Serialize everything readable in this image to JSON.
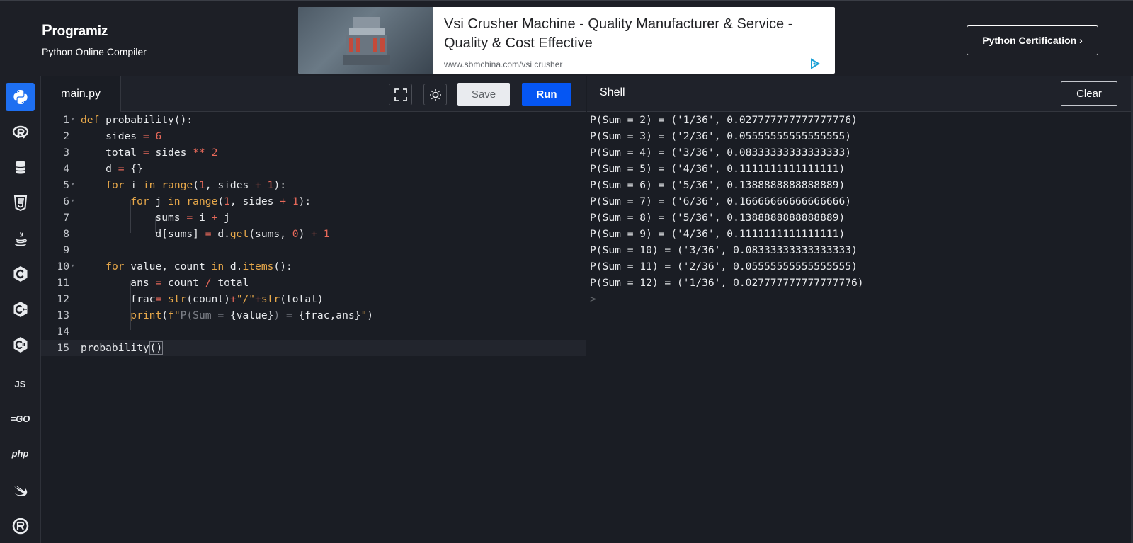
{
  "header": {
    "logo": "rogramiz",
    "logo_initial": "P",
    "subtitle": "Python Online Compiler",
    "cert_button": "Python Certification ›"
  },
  "ad": {
    "title": "Vsi Crusher Machine - Quality Manufacturer & Service - Quality & Cost Effective",
    "url": "www.sbmchina.com/vsi crusher"
  },
  "sidebar": {
    "items": [
      {
        "name": "python",
        "icon": "python-icon",
        "active": true
      },
      {
        "name": "r",
        "icon": "r-icon"
      },
      {
        "name": "sql",
        "icon": "database-icon"
      },
      {
        "name": "html",
        "icon": "html5-icon"
      },
      {
        "name": "java",
        "icon": "java-icon"
      },
      {
        "name": "c",
        "icon": "c-icon"
      },
      {
        "name": "cpp",
        "icon": "cpp-icon"
      },
      {
        "name": "csharp",
        "icon": "csharp-icon"
      },
      {
        "name": "js",
        "label": "JS"
      },
      {
        "name": "go",
        "label": "GO"
      },
      {
        "name": "php",
        "label": "php"
      },
      {
        "name": "swift",
        "icon": "swift-icon"
      },
      {
        "name": "rust",
        "icon": "rust-icon"
      }
    ]
  },
  "editor": {
    "file_tab": "main.py",
    "save_label": "Save",
    "run_label": "Run",
    "line_numbers": [
      "1",
      "2",
      "3",
      "4",
      "5",
      "6",
      "7",
      "8",
      "9",
      "10",
      "11",
      "12",
      "13",
      "14",
      "15"
    ]
  },
  "shell": {
    "title": "Shell",
    "clear_label": "Clear",
    "output": [
      "P(Sum = 2) = ('1/36', 0.027777777777777776)",
      "P(Sum = 3) = ('2/36', 0.05555555555555555)",
      "P(Sum = 4) = ('3/36', 0.08333333333333333)",
      "P(Sum = 5) = ('4/36', 0.1111111111111111)",
      "P(Sum = 6) = ('5/36', 0.1388888888888889)",
      "P(Sum = 7) = ('6/36', 0.16666666666666666)",
      "P(Sum = 8) = ('5/36', 0.1388888888888889)",
      "P(Sum = 9) = ('4/36', 0.1111111111111111)",
      "P(Sum = 10) = ('3/36', 0.08333333333333333)",
      "P(Sum = 11) = ('2/36', 0.05555555555555555)",
      "P(Sum = 12) = ('1/36', 0.027777777777777776)"
    ],
    "prompt": ">"
  },
  "colors": {
    "accent": "#0556f3",
    "active_lang": "#1e6ff1",
    "keyword": "#e7a84a",
    "number": "#e8695a",
    "background": "#1a1d24"
  }
}
